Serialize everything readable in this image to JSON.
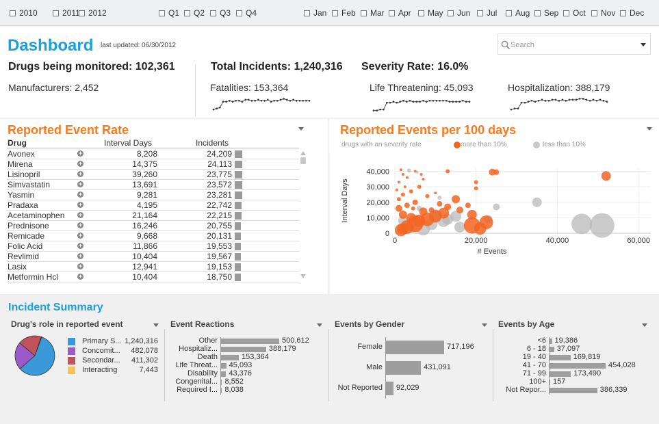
{
  "filters": {
    "years": [
      "2010",
      "2011",
      "2012"
    ],
    "quarters": [
      "Q1",
      "Q2",
      "Q3",
      "Q4"
    ],
    "months": [
      "Jan",
      "Feb",
      "Mar",
      "Apr",
      "May",
      "Jun",
      "Jul",
      "Aug",
      "Sep",
      "Oct",
      "Nov",
      "Dec"
    ]
  },
  "header": {
    "title": "Dashboard",
    "updated": "last updated: 06/30/2012",
    "search_placeholder": "Search"
  },
  "kpi": {
    "drugs": "Drugs being monitored: 102,361",
    "manufacturers": "Manufacturers: 2,452",
    "incidents": "Total Incidents: 1,240,316",
    "severity": "Severity Rate: 16.0%",
    "fatalities": "Fatalities: 153,364",
    "life": "Life Threatening: 45,093",
    "hosp": "Hospitalization: 388,179",
    "sparklines": [
      [
        2,
        3,
        4,
        10,
        10,
        11,
        10,
        11,
        11,
        10,
        12,
        12,
        11,
        11,
        12,
        11,
        11,
        12,
        10,
        11,
        11,
        12,
        13,
        12,
        11,
        12,
        11,
        11,
        11,
        11,
        11
      ],
      [
        1,
        1,
        2,
        2,
        9,
        9,
        10,
        9,
        10,
        11,
        10,
        11,
        10,
        10,
        10,
        11,
        10,
        11,
        11,
        11,
        11,
        11,
        11,
        10,
        10,
        10,
        10,
        11,
        10,
        10
      ],
      [
        2,
        3,
        3,
        9,
        9,
        10,
        11,
        10,
        11,
        12,
        11,
        11,
        12,
        12,
        11,
        12,
        11,
        12,
        12,
        12,
        13,
        13,
        12,
        11,
        12,
        11,
        12,
        11,
        10
      ]
    ]
  },
  "rate": {
    "title": "Reported Event Rate",
    "headers": [
      "Drug",
      "Interval Days",
      "Incidents"
    ],
    "rows": [
      {
        "drug": "Avonex",
        "days": "8,208",
        "inc": "24,209",
        "v": 24209
      },
      {
        "drug": "Mirena",
        "days": "14,375",
        "inc": "24,113",
        "v": 24113
      },
      {
        "drug": "Lisinopril",
        "days": "39,260",
        "inc": "23,775",
        "v": 23775
      },
      {
        "drug": "Simvastatin",
        "days": "13,691",
        "inc": "23,572",
        "v": 23572
      },
      {
        "drug": "Yasmin",
        "days": "9,281",
        "inc": "23,281",
        "v": 23281
      },
      {
        "drug": "Pradaxa",
        "days": "4,195",
        "inc": "22,742",
        "v": 22742
      },
      {
        "drug": "Acetaminophen",
        "days": "21,164",
        "inc": "22,215",
        "v": 22215
      },
      {
        "drug": "Prednisone",
        "days": "16,246",
        "inc": "20,755",
        "v": 20755
      },
      {
        "drug": "Remicade",
        "days": "9,668",
        "inc": "20,131",
        "v": 20131
      },
      {
        "drug": "Folic Acid",
        "days": "11,866",
        "inc": "19,553",
        "v": 19553
      },
      {
        "drug": "Revlimid",
        "days": "10,404",
        "inc": "19,567",
        "v": 19567
      },
      {
        "drug": "Lasix",
        "days": "12,941",
        "inc": "19,153",
        "v": 19153
      },
      {
        "drug": "Metformin Hcl",
        "days": "10,404",
        "inc": "18,750",
        "v": 18750
      }
    ]
  },
  "scatter": {
    "title": "Reported Events per 100 days",
    "legend_title": "drugs with an severity rate",
    "legend_more": "more than 10%",
    "legend_less": "less than 10%",
    "colors": {
      "more": "#f26522",
      "less": "#b5b5b5"
    },
    "ylabel": "Interval Days",
    "xlabel": "# Events",
    "yticks": [
      "0",
      "10,000",
      "20,000",
      "30,000",
      "40,000"
    ],
    "xticks": [
      "0",
      "20,000",
      "40,000",
      "60,000"
    ],
    "chart_data": {
      "type": "scatter",
      "xlabel": "# Events",
      "ylabel": "Interval Days",
      "xlim": [
        0,
        63000
      ],
      "ylim": [
        0,
        42000
      ],
      "series": [
        {
          "name": "more than 10%",
          "points": [
            [
              52000,
              37000,
              7
            ],
            [
              24000,
              39500,
              5
            ],
            [
              25000,
              39500,
              4
            ],
            [
              13000,
              40000,
              3
            ],
            [
              20000,
              33000,
              3
            ],
            [
              20000,
              29000,
              3
            ],
            [
              15000,
              22000,
              6
            ],
            [
              18000,
              18000,
              4
            ],
            [
              19000,
              12000,
              7
            ],
            [
              22500,
              7000,
              10
            ],
            [
              19000,
              5000,
              12
            ],
            [
              21000,
              3000,
              9
            ],
            [
              16000,
              15000,
              5
            ],
            [
              12000,
              13000,
              8
            ],
            [
              10000,
              11000,
              9
            ],
            [
              8000,
              9000,
              10
            ],
            [
              6000,
              8000,
              9
            ],
            [
              5000,
              6000,
              12
            ],
            [
              3000,
              4000,
              10
            ],
            [
              2000,
              3000,
              8
            ],
            [
              1500,
              2000,
              9
            ],
            [
              4000,
              10000,
              7
            ],
            [
              2000,
              12000,
              6
            ],
            [
              7000,
              14000,
              6
            ],
            [
              1000,
              16000,
              5
            ],
            [
              3000,
              18000,
              4
            ],
            [
              5000,
              20000,
              4
            ],
            [
              1000,
              22000,
              3
            ],
            [
              2000,
              25000,
              3
            ],
            [
              4000,
              27000,
              3
            ],
            [
              6000,
              30000,
              3
            ],
            [
              1000,
              33000,
              2
            ],
            [
              3000,
              36000,
              2
            ],
            [
              2000,
              38000,
              2
            ],
            [
              5000,
              40000,
              2
            ],
            [
              7000,
              35000,
              2
            ],
            [
              500,
              28000,
              2
            ],
            [
              8000,
              24000,
              3
            ],
            [
              10000,
              26000,
              2
            ],
            [
              11000,
              19000,
              4
            ],
            [
              13000,
              17000,
              5
            ],
            [
              9000,
              15000,
              4
            ],
            [
              4500,
              16000,
              3
            ],
            [
              2500,
              30000,
              2
            ],
            [
              1500,
              41000,
              2
            ],
            [
              6500,
              38000,
              2
            ]
          ]
        },
        {
          "name": "less than 10%",
          "points": [
            [
              51000,
              5000,
              18
            ],
            [
              46000,
              6000,
              15
            ],
            [
              35000,
              20000,
              7
            ],
            [
              10000,
              11000,
              10
            ],
            [
              12000,
              8000,
              9
            ],
            [
              15000,
              11000,
              8
            ],
            [
              13000,
              9000,
              8
            ],
            [
              9000,
              6000,
              9
            ],
            [
              7000,
              3000,
              10
            ],
            [
              4000,
              4000,
              9
            ],
            [
              5000,
              9000,
              7
            ],
            [
              2000,
              8000,
              7
            ],
            [
              23000,
              9000,
              6
            ],
            [
              25000,
              17000,
              5
            ],
            [
              3500,
              40500,
              3
            ],
            [
              5500,
              39500,
              2
            ],
            [
              2500,
              1000,
              4
            ],
            [
              16000,
              4000,
              8
            ],
            [
              6000,
              16000,
              4
            ],
            [
              11000,
              23000,
              3
            ]
          ]
        }
      ]
    }
  },
  "summary": {
    "title": "Incident Summary",
    "role": {
      "title": "Drug's role in reported event",
      "items": [
        {
          "label": "Primary S...",
          "value": "1,240,316",
          "v": 1240316,
          "color": "#3a9ad9"
        },
        {
          "label": "Concomit...",
          "value": "482,078",
          "v": 482078,
          "color": "#9b59c7"
        },
        {
          "label": "Secondar...",
          "value": "411,302",
          "v": 411302,
          "color": "#c0525c"
        },
        {
          "label": "Interacting",
          "value": "7,443",
          "v": 7443,
          "color": "#f6c25c"
        }
      ]
    },
    "reactions": {
      "title": "Event Reactions",
      "items": [
        {
          "label": "Other",
          "value": "500,612",
          "v": 500612
        },
        {
          "label": "Hospitaliz...",
          "value": "388,179",
          "v": 388179
        },
        {
          "label": "Death",
          "value": "153,364",
          "v": 153364
        },
        {
          "label": "Life Threat...",
          "value": "45,093",
          "v": 45093
        },
        {
          "label": "Disability",
          "value": "43,376",
          "v": 43376
        },
        {
          "label": "Congenital...",
          "value": "8,552",
          "v": 8552
        },
        {
          "label": "Required I...",
          "value": "8,038",
          "v": 8038
        }
      ]
    },
    "gender": {
      "title": "Events by Gender",
      "items": [
        {
          "label": "Female",
          "value": "717,196",
          "v": 717196
        },
        {
          "label": "Male",
          "value": "431,091",
          "v": 431091
        },
        {
          "label": "Not Reported",
          "value": "92,029",
          "v": 92029
        }
      ]
    },
    "age": {
      "title": "Events by Age",
      "items": [
        {
          "label": "<6",
          "value": "19,386",
          "v": 19386
        },
        {
          "label": "6 - 18",
          "value": "37,097",
          "v": 37097
        },
        {
          "label": "19 - 40",
          "value": "169,819",
          "v": 169819
        },
        {
          "label": "41 - 70",
          "value": "454,028",
          "v": 454028
        },
        {
          "label": "71 - 99",
          "value": "173,490",
          "v": 173490
        },
        {
          "label": "100+",
          "value": "157",
          "v": 157
        },
        {
          "label": "Not Repor...",
          "value": "386,339",
          "v": 386339
        }
      ]
    }
  }
}
